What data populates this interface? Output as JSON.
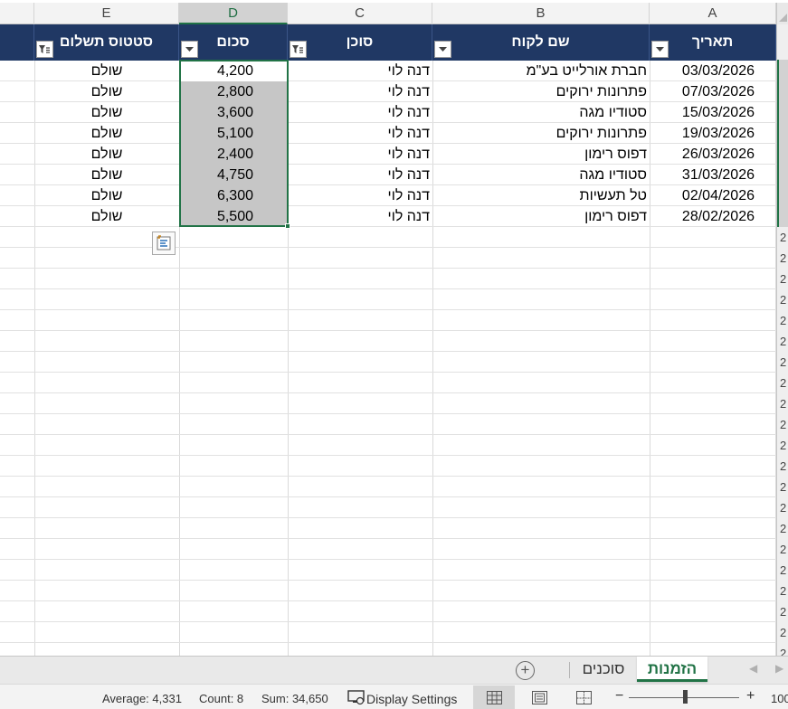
{
  "columns": [
    {
      "letter": "E"
    },
    {
      "letter": "D"
    },
    {
      "letter": "C"
    },
    {
      "letter": "B"
    },
    {
      "letter": "A"
    }
  ],
  "table": {
    "headers": {
      "payment_status": "סטטוס תשלום",
      "amount": "סכום",
      "agent": "סוכן",
      "customer_name": "שם לקוח",
      "date": "תאריך"
    },
    "rows": [
      {
        "date": "03/03/2026",
        "customer": "חברת אורלייט בע\"מ",
        "agent": "דנה לוי",
        "amount": "4,200",
        "status": "שולם"
      },
      {
        "date": "07/03/2026",
        "customer": "פתרונות ירוקים",
        "agent": "דנה לוי",
        "amount": "2,800",
        "status": "שולם"
      },
      {
        "date": "15/03/2026",
        "customer": "סטודיו מגה",
        "agent": "דנה לוי",
        "amount": "3,600",
        "status": "שולם"
      },
      {
        "date": "19/03/2026",
        "customer": "פתרונות ירוקים",
        "agent": "דנה לוי",
        "amount": "5,100",
        "status": "שולם"
      },
      {
        "date": "26/03/2026",
        "customer": "דפוס רימון",
        "agent": "דנה לוי",
        "amount": "2,400",
        "status": "שולם"
      },
      {
        "date": "31/03/2026",
        "customer": "סטודיו מגה",
        "agent": "דנה לוי",
        "amount": "4,750",
        "status": "שולם"
      },
      {
        "date": "02/04/2026",
        "customer": "טל תעשיות",
        "agent": "דנה לוי",
        "amount": "6,300",
        "status": "שולם"
      },
      {
        "date": "28/02/2026",
        "customer": "דפוס רימון",
        "agent": "דנה לוי",
        "amount": "5,500",
        "status": "שולם"
      }
    ]
  },
  "row_numbers_partial": [
    "2",
    "2",
    "2",
    "2",
    "2",
    "2",
    "2",
    "2",
    "2",
    "2",
    "2",
    "2",
    "2",
    "2",
    "2",
    "2",
    "2",
    "2",
    "2",
    "2",
    "2"
  ],
  "sheet_tabs": [
    {
      "label": "הזמנות",
      "active": true
    },
    {
      "label": "סוכנים",
      "active": false
    }
  ],
  "status_bar": {
    "average": "Average: 4,331",
    "count": "Count: 8",
    "sum": "Sum: 34,650",
    "display_settings": "Display Settings",
    "zoom_minus": "−",
    "zoom_plus": "+",
    "zoom_level": "100"
  },
  "colors": {
    "header_bg": "#203864",
    "accent": "#217346",
    "selection_fill": "#c6c6c6"
  }
}
